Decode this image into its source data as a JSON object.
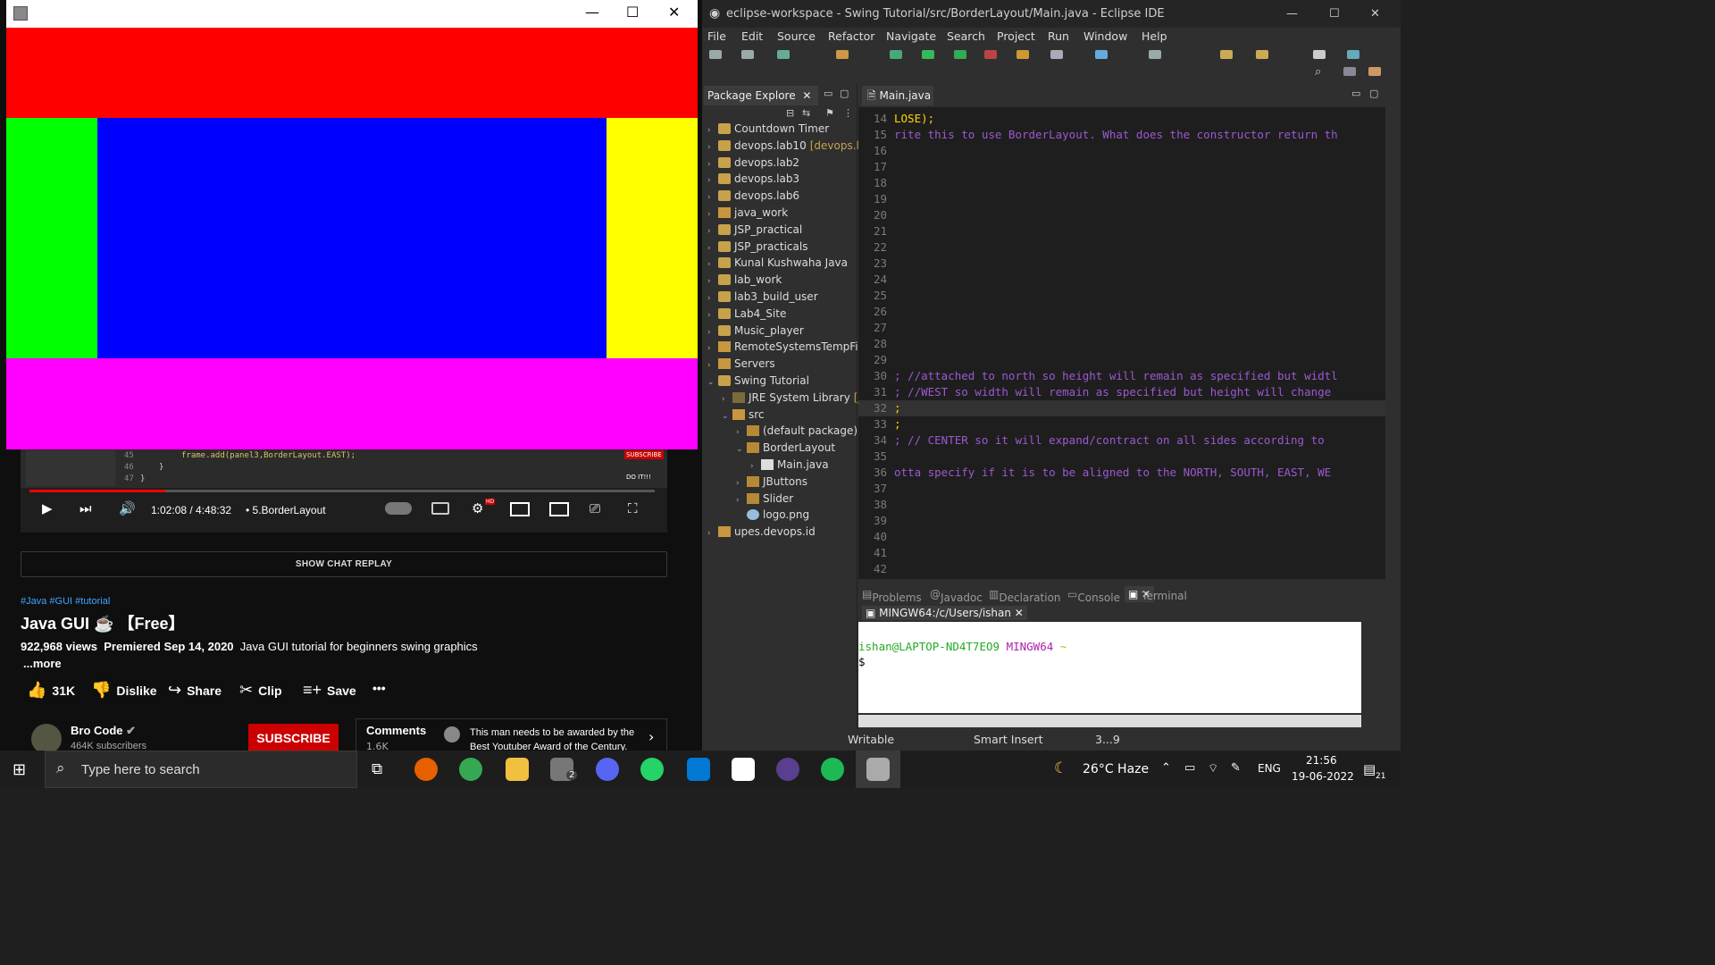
{
  "youtube": {
    "player": {
      "time": "1:02:08 / 4:48:32",
      "chapter": "• 5.BorderLayout",
      "progress": 0.217,
      "code_lines": [
        {
          "n": "45",
          "text": "frame.add(panel3,BorderLayout.EAST);"
        },
        {
          "n": "46",
          "text": "}"
        },
        {
          "n": "47",
          "text": "}"
        }
      ],
      "overlay_text": "DO IT!!!",
      "subscribe_overlay": "SUBSCRIBE",
      "hd_badge": "HD"
    },
    "show_chat_replay": "SHOW CHAT REPLAY",
    "hashtags": "#Java #GUI #tutorial",
    "title": "Java GUI ☕ 【Free】",
    "views": "922,968 views",
    "premiered": "Premiered Sep 14, 2020",
    "description": "Java GUI tutorial for beginners swing graphics",
    "more": "...more",
    "like_count": "31K",
    "dislike_label": "Dislike",
    "share_label": "Share",
    "clip_label": "Clip",
    "save_label": "Save",
    "channel": {
      "name": "Bro Code",
      "subscribers": "464K subscribers",
      "subscribe": "SUBSCRIBE"
    },
    "comments": {
      "label": "Comments",
      "count": "1.6K",
      "top": "This man needs to be awarded by the Best Youtuber Award of the Century."
    }
  },
  "swing_window": {
    "panel_colors": {
      "north": "#ff0000",
      "west": "#00ff00",
      "center": "#0000ff",
      "east": "#ffff00",
      "south": "#ff00ff"
    }
  },
  "eclipse": {
    "title": "eclipse-workspace - Swing Tutorial/src/BorderLayout/Main.java - Eclipse IDE",
    "menu": [
      "File",
      "Edit",
      "Source",
      "Refactor",
      "Navigate",
      "Search",
      "Project",
      "Run",
      "Window",
      "Help"
    ],
    "package_explorer_tab": "Package Explore",
    "tree": [
      {
        "label": "Countdown Timer",
        "level": 0,
        "icon": "proj"
      },
      {
        "label": "devops.lab10",
        "suffix": "[devops.lab",
        "level": 0,
        "icon": "proj"
      },
      {
        "label": "devops.lab2",
        "level": 0,
        "icon": "proj"
      },
      {
        "label": "devops.lab3",
        "level": 0,
        "icon": "proj"
      },
      {
        "label": "devops.lab6",
        "level": 0,
        "icon": "proj"
      },
      {
        "label": "java_work",
        "level": 0,
        "icon": "fld"
      },
      {
        "label": "JSP_practical",
        "level": 0,
        "icon": "proj"
      },
      {
        "label": "JSP_practicals",
        "level": 0,
        "icon": "proj"
      },
      {
        "label": "Kunal Kushwaha Java",
        "level": 0,
        "icon": "proj"
      },
      {
        "label": "lab_work",
        "level": 0,
        "icon": "proj"
      },
      {
        "label": "lab3_build_user",
        "level": 0,
        "icon": "proj"
      },
      {
        "label": "Lab4_Site",
        "level": 0,
        "icon": "proj"
      },
      {
        "label": "Music_player",
        "level": 0,
        "icon": "proj"
      },
      {
        "label": "RemoteSystemsTempFile",
        "level": 0,
        "icon": "fld"
      },
      {
        "label": "Servers",
        "level": 0,
        "icon": "fld"
      },
      {
        "label": "Swing Tutorial",
        "level": 0,
        "icon": "proj"
      },
      {
        "label": "JRE System Library",
        "suffix": "[Ja",
        "level": 1,
        "icon": "lib"
      },
      {
        "label": "src",
        "level": 1,
        "icon": "fld"
      },
      {
        "label": "(default package)",
        "level": 2,
        "icon": "pkg"
      },
      {
        "label": "BorderLayout",
        "level": 2,
        "icon": "pkg"
      },
      {
        "label": "Main.java",
        "level": 3,
        "icon": "jfile"
      },
      {
        "label": "JButtons",
        "level": 2,
        "icon": "pkg"
      },
      {
        "label": "Slider",
        "level": 2,
        "icon": "pkg"
      },
      {
        "label": "logo.png",
        "level": 2,
        "icon": "img"
      },
      {
        "label": "upes.devops.id",
        "level": 0,
        "icon": "fld"
      }
    ],
    "editor_tab": "Main.java",
    "code": [
      {
        "n": "14",
        "text": "LOSE);",
        "cls": "kw"
      },
      {
        "n": "15",
        "text": "rite this to use BorderLayout. What does the constructor return th",
        "cls": "cm"
      },
      {
        "n": "16",
        "text": ""
      },
      {
        "n": "17",
        "text": ""
      },
      {
        "n": "18",
        "text": ""
      },
      {
        "n": "19",
        "text": ""
      },
      {
        "n": "20",
        "text": ""
      },
      {
        "n": "21",
        "text": ""
      },
      {
        "n": "22",
        "text": ""
      },
      {
        "n": "23",
        "text": ""
      },
      {
        "n": "24",
        "text": ""
      },
      {
        "n": "25",
        "text": ""
      },
      {
        "n": "26",
        "text": ""
      },
      {
        "n": "27",
        "text": ""
      },
      {
        "n": "28",
        "text": ""
      },
      {
        "n": "29",
        "text": ""
      },
      {
        "n": "30",
        "text": "; //attached to north so height will remain as specified but widtl",
        "cls": "cm"
      },
      {
        "n": "31",
        "text": "; //WEST so width will remain as specified but height will change",
        "cls": "cm"
      },
      {
        "n": "32",
        "text": ";",
        "cls": "kw"
      },
      {
        "n": "33",
        "text": ";",
        "cls": "kw"
      },
      {
        "n": "34",
        "text": "; // CENTER so it will expand/contract on all sides according to",
        "cls": "cm"
      },
      {
        "n": "35",
        "text": ""
      },
      {
        "n": "36",
        "text": "otta specify if it is to be aligned to the NORTH, SOUTH, EAST, WE",
        "cls": "cm"
      },
      {
        "n": "37",
        "text": ""
      },
      {
        "n": "38",
        "text": ""
      },
      {
        "n": "39",
        "text": ""
      },
      {
        "n": "40",
        "text": ""
      },
      {
        "n": "41",
        "text": ""
      },
      {
        "n": "42",
        "text": ""
      }
    ],
    "bottom_tabs": [
      "Problems",
      "Javadoc",
      "Declaration",
      "Console",
      "Terminal"
    ],
    "terminal_tab": "MINGW64:/c/Users/ishan",
    "terminal_prompt": "ishan@LAPTOP-ND4T7EO9",
    "terminal_env": "MINGW64",
    "terminal_tilde": "~",
    "terminal_dollar": "$",
    "status": {
      "writable": "Writable",
      "insert": "Smart Insert",
      "pos": "3...9"
    }
  },
  "taskbar": {
    "search_placeholder": "Type here to search",
    "weather": "26°C  Haze",
    "lang": "ENG",
    "time": "21:56",
    "date": "19-06-2022",
    "notifications": "21",
    "app_badge": "2"
  }
}
